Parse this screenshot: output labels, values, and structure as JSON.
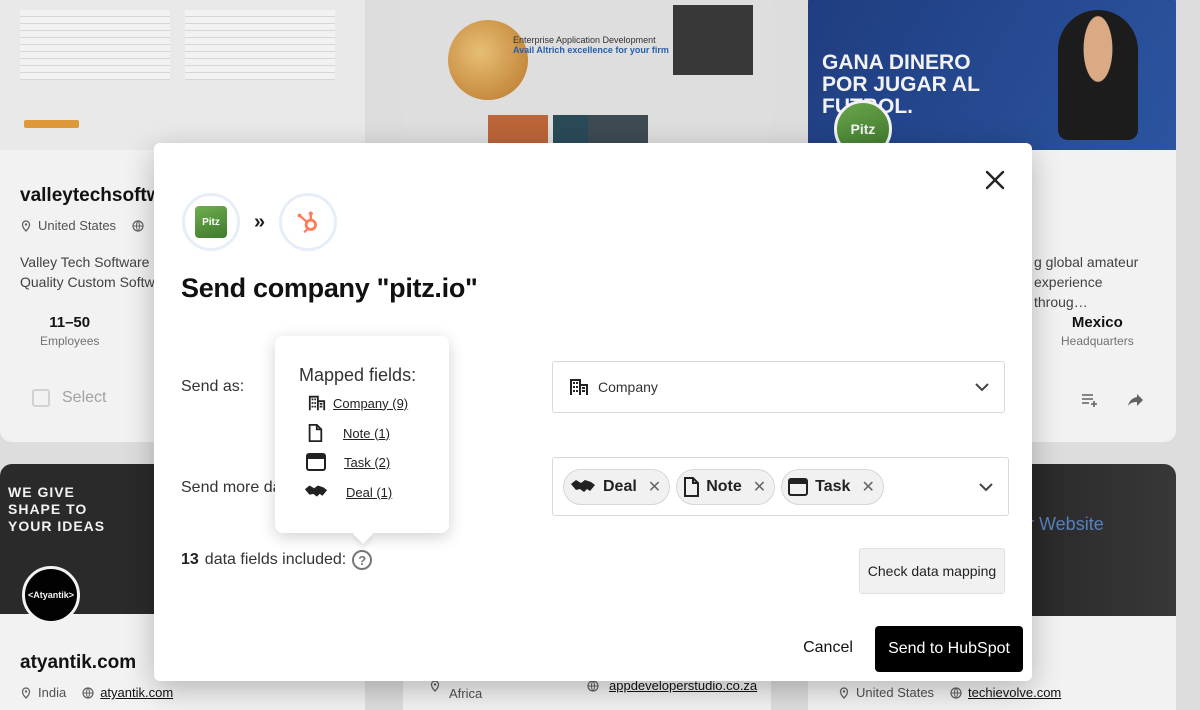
{
  "cards": {
    "c1": {
      "site": "valleytechsoftwa",
      "country": "United States",
      "desc_line1": "Valley Tech Software h",
      "desc_line2": "Quality Custom Softwa",
      "employees_value": "11–50",
      "employees_label": "Employees",
      "select_label": "Select"
    },
    "c3": {
      "desc_line1": "g global amateur",
      "desc_line2": "experience throug…",
      "hq_value": "Mexico",
      "hq_label": "Headquarters",
      "banner": "GANA DINERO POR JUGAR AL FUTBOL.",
      "logo_text": "Pitz"
    },
    "c2": {
      "banner_line1": "Enterprise Application Development",
      "banner_line2": "Avail Altrich excellence for your firm"
    },
    "c4": {
      "banner": "WE GIVE SHAPE TO YOUR IDEAS",
      "logo_text": "<Atyantik>",
      "site": "atyantik.com",
      "country": "India",
      "link": "atyantik.com"
    },
    "c5": {
      "country": "Africa",
      "link": "appdeveloperstudio.co.za"
    },
    "c6": {
      "banner": "ur Website",
      "country": "United States",
      "link": "techievolve.com"
    }
  },
  "modal": {
    "title": "Send company \"pitz.io\"",
    "source_logo_text": "Pitz",
    "send_as_label": "Send as:",
    "send_as_value": "Company",
    "send_more_label": "Send more da",
    "chips": [
      {
        "label": "Deal",
        "icon": "handshake-icon"
      },
      {
        "label": "Note",
        "icon": "note-icon"
      },
      {
        "label": "Task",
        "icon": "task-icon"
      }
    ],
    "fields_count": "13",
    "fields_text": "data fields included:",
    "check_mapping": "Check data mapping",
    "cancel": "Cancel",
    "send": "Send to HubSpot"
  },
  "popover": {
    "title": "Mapped fields:",
    "items": [
      {
        "label": "Company (9)",
        "icon": "building-icon"
      },
      {
        "label": "Note (1)",
        "icon": "note-icon"
      },
      {
        "label": "Task (2)",
        "icon": "task-icon"
      },
      {
        "label": "Deal (1)",
        "icon": "handshake-icon"
      }
    ]
  },
  "colors": {
    "primary_button": "#000000",
    "hubspot_orange": "#ff7a59",
    "card_banner_blue": "#1b3f8f"
  }
}
